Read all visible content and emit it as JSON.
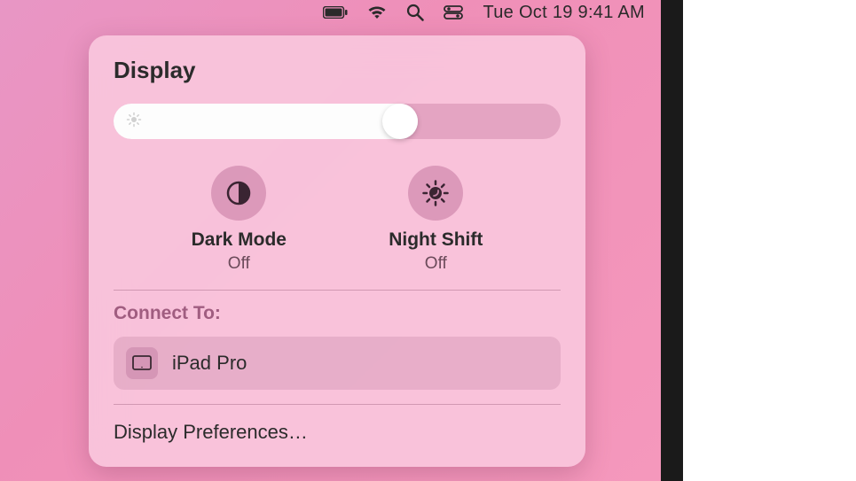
{
  "menubar": {
    "date_time": "Tue Oct 19  9:41 AM"
  },
  "panel": {
    "title": "Display",
    "brightness_percent": 68,
    "toggles": {
      "dark_mode": {
        "label": "Dark Mode",
        "status": "Off"
      },
      "night_shift": {
        "label": "Night Shift",
        "status": "Off"
      }
    },
    "connect_label": "Connect To:",
    "devices": [
      {
        "name": "iPad Pro"
      }
    ],
    "preferences_label": "Display Preferences…"
  }
}
